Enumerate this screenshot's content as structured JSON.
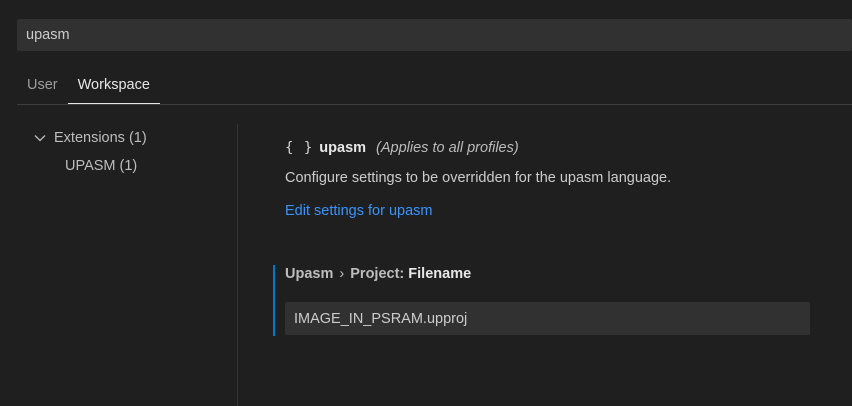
{
  "search": {
    "value": "upasm"
  },
  "tabs": [
    {
      "label": "User",
      "active": false
    },
    {
      "label": "Workspace",
      "active": true
    }
  ],
  "toc": {
    "group_label": "Extensions (1)",
    "child_label": "UPASM (1)",
    "chevron_icon": "chevron-down-icon"
  },
  "language_section": {
    "braces": "{ }",
    "language": "upasm",
    "scope_note": "(Applies to all profiles)",
    "description": "Configure settings to be overridden for the upasm language.",
    "edit_link": "Edit settings for upasm"
  },
  "setting": {
    "category": "Upasm",
    "separator": "›",
    "subcategory": "Project:",
    "key": "Filename",
    "value": "IMAGE_IN_PSRAM.upproj"
  },
  "colors": {
    "background": "#1f1f1f",
    "input_background": "#313131",
    "link": "#3794ff",
    "modified_indicator": "#0078d4"
  }
}
